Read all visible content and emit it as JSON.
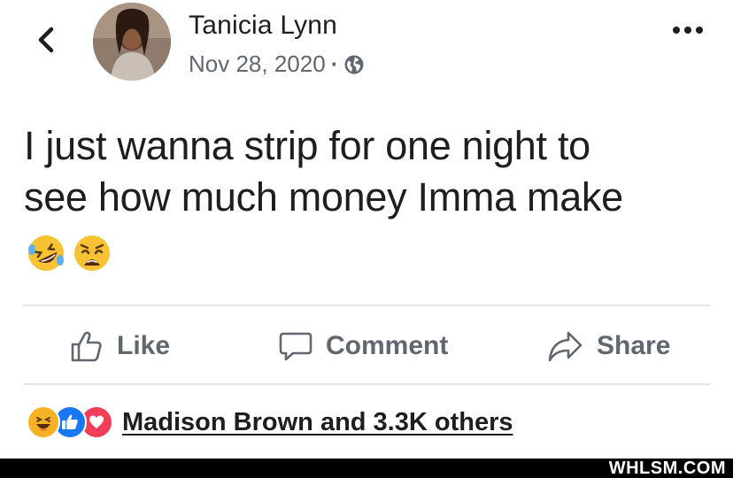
{
  "post": {
    "author": "Tanicia Lynn",
    "date": "Nov 28, 2020",
    "separator": "·",
    "privacy_icon": "globe-icon",
    "text_line1": "I just wanna strip for one night to",
    "text_line2": "see how much money Imma make",
    "emojis": [
      "rolling-on-floor-laughing-emoji",
      "weary-face-emoji"
    ]
  },
  "actions": {
    "like_label": "Like",
    "comment_label": "Comment",
    "share_label": "Share"
  },
  "reactions": {
    "icons": [
      "haha-reaction-icon",
      "like-reaction-icon",
      "love-reaction-icon"
    ],
    "summary": "Madison Brown and 3.3K others"
  },
  "watermark": "WHLSM.COM",
  "colors": {
    "text": "#1c1e21",
    "secondary": "#606770",
    "like_blue": "#1877f2",
    "love_red": "#f33e58",
    "haha_yellow": "#f7b125"
  }
}
